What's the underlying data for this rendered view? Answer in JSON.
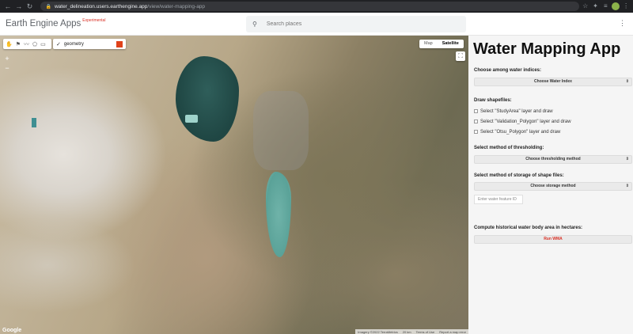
{
  "browser": {
    "url_host": "water_delineation.users.earthengine.app",
    "url_path": "/view/water-mapping-app"
  },
  "header": {
    "brand": "Earth Engine Apps",
    "badge": "Experimental",
    "search_placeholder": "Search places"
  },
  "map": {
    "layer_name": "geometry",
    "layer_color": "#e0421a",
    "maptype_map": "Map",
    "maptype_satellite": "Satellite",
    "zoom_in": "+",
    "zoom_out": "−",
    "google_logo": "Google",
    "attribution": [
      "Imagery ©2022 TerraMetrics",
      "20 km",
      "Terms of Use",
      "Report a map error"
    ]
  },
  "panel": {
    "title": "Water Mapping App",
    "index_label": "Choose among water indices:",
    "index_select": "Choose Water Index",
    "shapefiles_label": "Draw shapefiles:",
    "checks": [
      "Select \"StudyArea\" layer and draw",
      "Select \"Validation_Polygon\" layer and draw",
      "Select \"Otsu_Polygon\" layer and draw"
    ],
    "threshold_label": "Select method of thresholding:",
    "threshold_select": "Choose thresholding method",
    "storage_label": "Select method of storage of shape files:",
    "storage_select": "Choose storage method",
    "feature_placeholder": "Enter water feature ID",
    "compute_label": "Compute historical water body area in hectares:",
    "run_button": "Run WMA"
  }
}
